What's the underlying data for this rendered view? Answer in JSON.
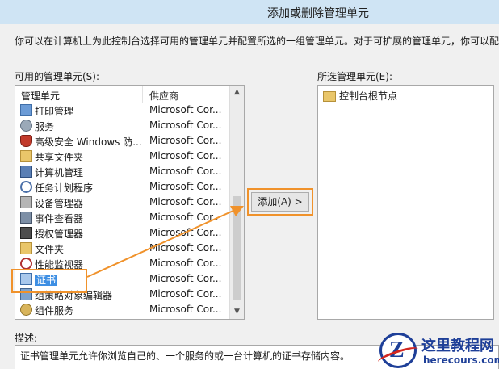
{
  "window": {
    "title": "添加或删除管理单元"
  },
  "intro_text": "你可以在计算机上为此控制台选择可用的管理单元并配置所选的一组管理单元。对于可扩展的管理单元，你可以配",
  "available": {
    "label": "可用的管理单元(S):",
    "columns": [
      "管理单元",
      "供应商"
    ],
    "items": [
      {
        "name": "打印管理",
        "vendor": "Microsoft Cor...",
        "icon": "printer-icon"
      },
      {
        "name": "服务",
        "vendor": "Microsoft Cor...",
        "icon": "services-gear-icon"
      },
      {
        "name": "高级安全 Windows 防...",
        "vendor": "Microsoft Cor...",
        "icon": "firewall-shield-icon"
      },
      {
        "name": "共享文件夹",
        "vendor": "Microsoft Cor...",
        "icon": "shared-folder-icon"
      },
      {
        "name": "计算机管理",
        "vendor": "Microsoft Cor...",
        "icon": "computer-management-icon"
      },
      {
        "name": "任务计划程序",
        "vendor": "Microsoft Cor...",
        "icon": "clock-icon"
      },
      {
        "name": "设备管理器",
        "vendor": "Microsoft Cor...",
        "icon": "device-manager-icon"
      },
      {
        "name": "事件查看器",
        "vendor": "Microsoft Cor...",
        "icon": "event-viewer-icon"
      },
      {
        "name": "授权管理器",
        "vendor": "Microsoft Cor...",
        "icon": "authorization-icon"
      },
      {
        "name": "文件夹",
        "vendor": "Microsoft Cor...",
        "icon": "folder-icon"
      },
      {
        "name": "性能监视器",
        "vendor": "Microsoft Cor...",
        "icon": "performance-monitor-icon"
      },
      {
        "name": "证书",
        "vendor": "Microsoft Cor...",
        "icon": "certificate-icon",
        "selected": true
      },
      {
        "name": "组策略对象编辑器",
        "vendor": "Microsoft Cor...",
        "icon": "group-policy-icon"
      },
      {
        "name": "组件服务",
        "vendor": "Microsoft Cor...",
        "icon": "component-services-icon"
      }
    ]
  },
  "add_button": {
    "label": "添加(A) >"
  },
  "selected": {
    "label": "所选管理单元(E):",
    "root": "控制台根节点"
  },
  "description": {
    "label": "描述:",
    "text": "证书管理单元允许你浏览自己的、一个服务的或一台计算机的证书存储内容。"
  },
  "watermark": {
    "name": "这里教程网",
    "url": "herecours.com"
  },
  "colors": {
    "highlight": "#f0922b",
    "selection": "#3d8ee3",
    "title_bar": "#cfe4f4",
    "watermark": "#1e3f98"
  }
}
